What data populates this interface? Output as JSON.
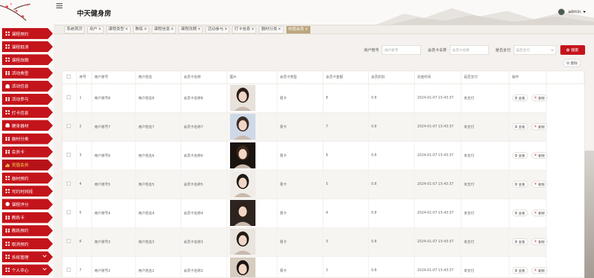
{
  "app": {
    "title": "中天健身房"
  },
  "user": {
    "name": "admin"
  },
  "sidebar": {
    "items": [
      {
        "label": "课程预约",
        "icon": "grid-icon"
      },
      {
        "label": "课程取消",
        "icon": "grid-icon"
      },
      {
        "label": "课程改期",
        "icon": "grid-icon"
      },
      {
        "label": "活动类型",
        "icon": "grid-icon"
      },
      {
        "label": "活动信息",
        "icon": "person-icon"
      },
      {
        "label": "活动参与",
        "icon": "grid-icon"
      },
      {
        "label": "打卡信息",
        "icon": "grid-icon"
      },
      {
        "label": "健身器材",
        "icon": "person-icon"
      },
      {
        "label": "器材分类",
        "icon": "grid-icon"
      },
      {
        "label": "会员卡",
        "icon": "grid-icon"
      },
      {
        "label": "充值会员",
        "icon": "bar-chart-icon",
        "active": true
      },
      {
        "label": "器材预约",
        "icon": "grid-icon"
      },
      {
        "label": "可约时间段",
        "icon": "grid-icon"
      },
      {
        "label": "课程评分",
        "icon": "location-icon"
      },
      {
        "label": "教练卡",
        "icon": "grid-icon"
      },
      {
        "label": "教练预约",
        "icon": "grid-icon"
      },
      {
        "label": "取消预约",
        "icon": "grid-icon"
      },
      {
        "label": "系统管理",
        "icon": "grid-icon",
        "expandable": true
      },
      {
        "label": "个人中心",
        "icon": "grid-icon",
        "expandable": true
      }
    ]
  },
  "tabs": [
    {
      "label": "系统首页",
      "closable": false
    },
    {
      "label": "用户",
      "closable": true
    },
    {
      "label": "课程类型",
      "closable": true
    },
    {
      "label": "教练",
      "closable": true
    },
    {
      "label": "课程信息",
      "closable": true
    },
    {
      "label": "课程改期",
      "closable": true
    },
    {
      "label": "活动参与",
      "closable": true
    },
    {
      "label": "打卡信息",
      "closable": true
    },
    {
      "label": "器材分类",
      "closable": true
    },
    {
      "label": "充值会员",
      "closable": true,
      "active": true
    }
  ],
  "search": {
    "account_label": "用户账号",
    "account_placeholder": "用户账号",
    "card_label": "会员卡名称",
    "card_placeholder": "会员卡名称",
    "paid_label": "是否支付",
    "paid_placeholder": "是否支付",
    "search_button": "搜索",
    "delete_button": "删除"
  },
  "table": {
    "headers": [
      "序号",
      "用户账号",
      "用户姓名",
      "会员卡名称",
      "图片",
      "会员卡类型",
      "会员卡金额",
      "会员折扣",
      "充值时间",
      "是否支付",
      "操作"
    ],
    "view_label": "查看",
    "delete_label": "删除",
    "rows": [
      {
        "no": "1",
        "account": "用户账号8",
        "name": "用户姓名8",
        "card": "会员卡名称8",
        "photo": "photo-1",
        "type": "周卡",
        "amount": "8",
        "discount": "0.8",
        "time": "2024-01-07 15:43:37",
        "paid": "未支付"
      },
      {
        "no": "2",
        "account": "用户账号7",
        "name": "用户姓名7",
        "card": "会员卡名称7",
        "photo": "photo-2",
        "type": "周卡",
        "amount": "7",
        "discount": "0.8",
        "time": "2024-01-07 15:43:37",
        "paid": "未支付"
      },
      {
        "no": "3",
        "account": "用户账号6",
        "name": "用户姓名6",
        "card": "会员卡名称6",
        "photo": "photo-3",
        "type": "周卡",
        "amount": "6",
        "discount": "0.8",
        "time": "2024-01-07 15:43:37",
        "paid": "未支付"
      },
      {
        "no": "4",
        "account": "用户账号5",
        "name": "用户姓名5",
        "card": "会员卡名称5",
        "photo": "photo-4",
        "type": "周卡",
        "amount": "5",
        "discount": "0.8",
        "time": "2024-01-07 15:43:37",
        "paid": "未支付"
      },
      {
        "no": "5",
        "account": "用户账号4",
        "name": "用户姓名4",
        "card": "会员卡名称4",
        "photo": "photo-5",
        "type": "周卡",
        "amount": "4",
        "discount": "0.8",
        "time": "2024-01-07 15:43:37",
        "paid": "未支付"
      },
      {
        "no": "6",
        "account": "用户账号3",
        "name": "用户姓名3",
        "card": "会员卡名称3",
        "photo": "photo-6",
        "type": "周卡",
        "amount": "3",
        "discount": "0.8",
        "time": "2024-01-07 15:43:37",
        "paid": "未支付"
      },
      {
        "no": "7",
        "account": "用户账号2",
        "name": "用户姓名2",
        "card": "会员卡名称2",
        "photo": "photo-7",
        "type": "周卡",
        "amount": "2",
        "discount": "0.8",
        "time": "2024-01-07 15:43:37",
        "paid": "未支付"
      }
    ]
  },
  "colors": {
    "accent": "#c4141b",
    "active_tab": "#bba77d",
    "active_menu_text": "#ffd54a"
  }
}
